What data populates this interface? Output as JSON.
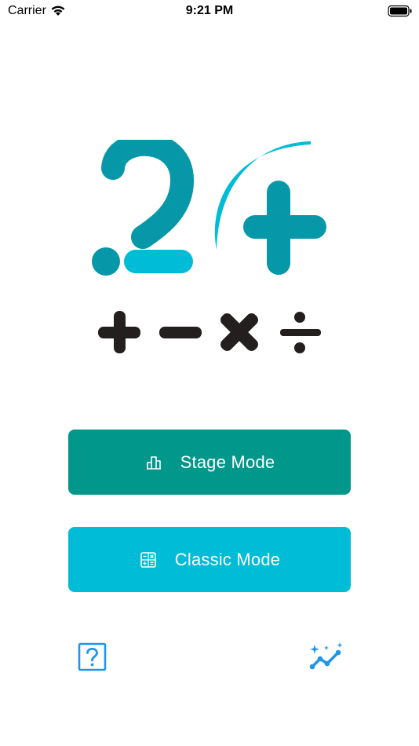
{
  "status_bar": {
    "carrier": "Carrier",
    "time": "9:21 PM",
    "wifi_icon": "wifi-icon",
    "battery_icon": "battery-icon"
  },
  "logo": {
    "text": "24",
    "icon": "app-logo-24",
    "colors": {
      "dark_teal": "#0698a8",
      "light_cyan": "#00bcd6"
    }
  },
  "operators": {
    "icon": "arithmetic-operators-icon",
    "color": "#231f1f"
  },
  "buttons": {
    "stage": {
      "label": "Stage Mode",
      "icon": "stage-chart-icon",
      "color": "#01978a"
    },
    "classic": {
      "label": "Classic Mode",
      "icon": "calculator-icon",
      "color": "#00bcd6"
    }
  },
  "footer": {
    "help_icon": "help-question-icon",
    "stats_icon": "statistics-trend-icon",
    "icon_color": "#2196e6"
  }
}
